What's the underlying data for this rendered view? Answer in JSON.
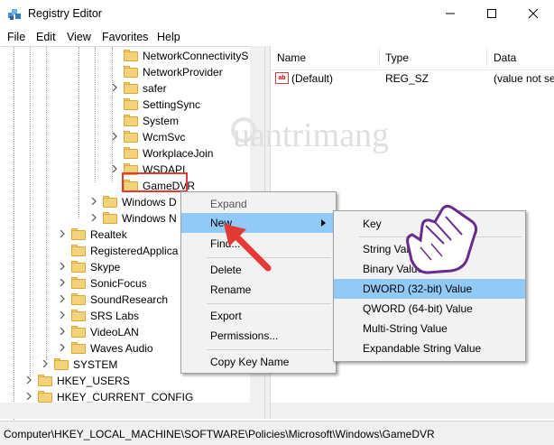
{
  "window": {
    "title": "Registry Editor",
    "icon": "registry-editor-icon",
    "controls": [
      "minimize",
      "maximize",
      "close"
    ]
  },
  "menu": [
    "File",
    "Edit",
    "View",
    "Favorites",
    "Help"
  ],
  "tree": {
    "items": [
      {
        "label": "NetworkConnectivityS",
        "expander": false
      },
      {
        "label": "NetworkProvider",
        "expander": false
      },
      {
        "label": "safer",
        "expander": true
      },
      {
        "label": "SettingSync",
        "expander": false
      },
      {
        "label": "System",
        "expander": false
      },
      {
        "label": "WcmSvc",
        "expander": true
      },
      {
        "label": "WorkplaceJoin",
        "expander": false
      },
      {
        "label": "WSDAPI",
        "expander": true
      },
      {
        "label": "GameDVR",
        "expander": false,
        "selected": true
      },
      {
        "label": "Windows D",
        "expander": true
      },
      {
        "label": "Windows N",
        "expander": true
      },
      {
        "label": "Realtek",
        "expander": true
      },
      {
        "label": "RegisteredApplica",
        "expander": false
      },
      {
        "label": "Skype",
        "expander": true
      },
      {
        "label": "SonicFocus",
        "expander": true
      },
      {
        "label": "SoundResearch",
        "expander": true
      },
      {
        "label": "SRS Labs",
        "expander": true
      },
      {
        "label": "VideoLAN",
        "expander": true
      },
      {
        "label": "Waves Audio",
        "expander": true
      },
      {
        "label": "SYSTEM",
        "expander": true
      },
      {
        "label": "HKEY_USERS",
        "expander": true
      },
      {
        "label": "HKEY_CURRENT_CONFIG",
        "expander": true
      }
    ]
  },
  "values_pane": {
    "columns": [
      "Name",
      "Type",
      "Data"
    ],
    "rows": [
      {
        "name": "(Default)",
        "type": "REG_SZ",
        "data": "(value not se"
      }
    ]
  },
  "context_menu": {
    "items": [
      "Expand",
      "New",
      "Find...",
      "Delete",
      "Rename",
      "Export",
      "Permissions...",
      "Copy Key Name"
    ],
    "highlighted": "New"
  },
  "submenu": {
    "items": [
      "Key",
      "String Value",
      "Binary Value",
      "DWORD (32-bit) Value",
      "QWORD (64-bit) Value",
      "Multi-String Value",
      "Expandable String Value"
    ],
    "highlighted": "DWORD (32-bit) Value"
  },
  "status_bar": {
    "path": "Computer\\HKEY_LOCAL_MACHINE\\SOFTWARE\\Policies\\Microsoft\\Windows\\GameDVR"
  },
  "watermark": "uantrimang",
  "colors": {
    "highlight": "#91c9f7",
    "annotation_red": "#e53935",
    "folder": "#f4d27a"
  }
}
